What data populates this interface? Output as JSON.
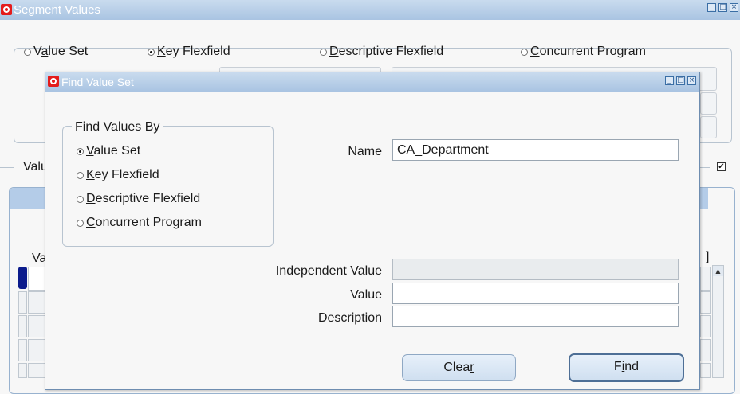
{
  "background_window": {
    "title": "Segment Values",
    "query_by": {
      "options": [
        {
          "label": "Value Set",
          "underline": "a",
          "pre": "V",
          "post": "lue Set",
          "selected": false
        },
        {
          "label": "Key Flexfield",
          "pre": "",
          "underline": "K",
          "post": "ey Flexfield",
          "selected": true
        },
        {
          "label": "Descriptive Flexfield",
          "pre": "",
          "underline": "D",
          "post": "escriptive Flexfield",
          "selected": false
        },
        {
          "label": "Concurrent Program",
          "pre": "",
          "underline": "C",
          "post": "oncurrent Program",
          "selected": false
        }
      ]
    },
    "values_label_partial": "Valu",
    "grid_header_partial": "Va",
    "bracket": "]"
  },
  "dialog": {
    "title": "Find Value Set",
    "find_values_by": {
      "title": "Find Values By",
      "options": [
        {
          "label": "Value Set",
          "pre": "",
          "underline": "V",
          "post": "alue Set",
          "selected": true
        },
        {
          "label": "Key Flexfield",
          "pre": "",
          "underline": "K",
          "post": "ey Flexfield",
          "selected": false
        },
        {
          "label": "Descriptive Flexfield",
          "pre": "",
          "underline": "D",
          "post": "escriptive Flexfield",
          "selected": false
        },
        {
          "label": "Concurrent Program",
          "pre": "",
          "underline": "C",
          "post": "oncurrent Program",
          "selected": false
        }
      ]
    },
    "name": {
      "label": "Name",
      "value": "CA_Department"
    },
    "independent_value": {
      "label": "Independent Value",
      "value": ""
    },
    "value": {
      "label": "Value",
      "value": ""
    },
    "description": {
      "label": "Description",
      "value": ""
    },
    "buttons": {
      "clear": {
        "pre": "Clea",
        "underline": "r",
        "post": ""
      },
      "find": {
        "pre": "F",
        "underline": "i",
        "post": "nd"
      }
    }
  },
  "colors": {
    "titlebar": "#b4cce8",
    "oracle_red": "#e41c1c",
    "button_face": "#dbe7f5"
  },
  "icons": [
    "oracle-logo-icon",
    "minimize-icon",
    "maximize-icon",
    "close-icon",
    "checkbox-checked-icon",
    "scroll-up-icon"
  ]
}
